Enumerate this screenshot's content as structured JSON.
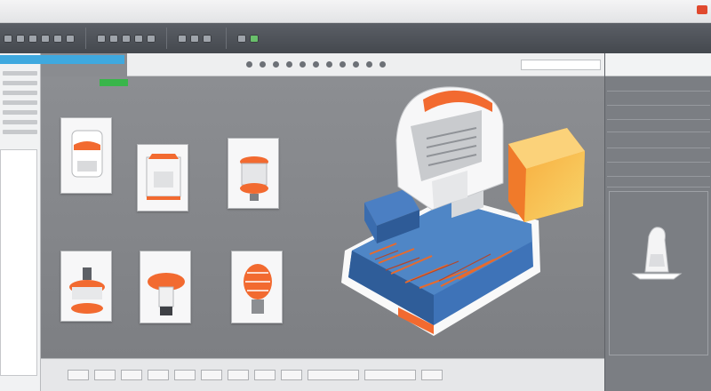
{
  "menubar": {
    "items": [
      "",
      "",
      "",
      "",
      "",
      "",
      "",
      "",
      "",
      "",
      "",
      ""
    ]
  },
  "ribbon": {
    "text_a": "",
    "text_b": ""
  },
  "toolbar": {
    "zoom_label": ""
  },
  "grid": {
    "header": "",
    "thumbnails": [
      {
        "label": ""
      },
      {
        "label": ""
      },
      {
        "label": ""
      },
      {
        "label": ""
      },
      {
        "label": ""
      },
      {
        "label": ""
      }
    ]
  },
  "rightpanel": {
    "title": "",
    "rows": [
      "",
      "",
      "",
      "",
      "",
      "",
      "",
      ""
    ],
    "caption_a": "",
    "caption_b": ""
  },
  "statusbar": {
    "text": ""
  },
  "colors": {
    "accent_orange": "#f26a30",
    "accent_blue": "#3fa9df",
    "accent_green": "#39b54a",
    "close_red": "#e0492e",
    "board_blue": "#3e73b8"
  },
  "icons": [
    "close-icon",
    "save-icon",
    "undo-icon",
    "redo-icon",
    "rotate-icon",
    "zoom-icon"
  ]
}
